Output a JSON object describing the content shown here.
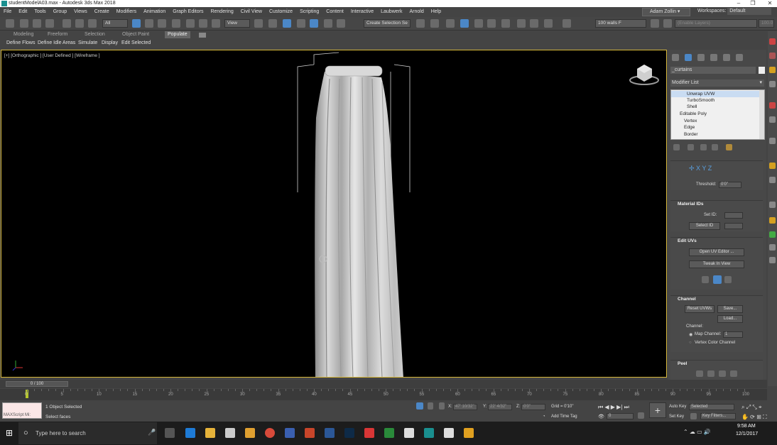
{
  "window": {
    "title": "studentModelA03.max - Autodesk 3ds Max 2018",
    "minimize": "–",
    "maximize": "❐",
    "close": "✕"
  },
  "menu": [
    "File",
    "Edit",
    "Tools",
    "Group",
    "Views",
    "Create",
    "Modifiers",
    "Animation",
    "Graph Editors",
    "Rendering",
    "Civil View",
    "Customize",
    "Scripting",
    "Content",
    "Interactive",
    "Laubwerk",
    "Arnold",
    "Help"
  ],
  "user": {
    "name": "Adam Zollin",
    "workspace_label": "Workspaces:",
    "workspace": "Default"
  },
  "toolbar": {
    "filter": "All",
    "ref_coord": "View",
    "selection_set": "Create Selection Se",
    "walls": "100  walls F",
    "layers_placeholder": "(Enable Layers)",
    "layers_value": "100.0"
  },
  "ribbon": {
    "tabs": [
      "Modeling",
      "Freeform",
      "Selection",
      "Object Paint",
      "Populate"
    ],
    "subtabs": [
      "Define Flows",
      "Define Idle Areas",
      "Simulate",
      "Display",
      "Edit Selected"
    ]
  },
  "viewport": {
    "label": "[+] [Orthographic ] [User Defined ] [Wireframe ]"
  },
  "command_panel": {
    "object_name": "_curtains",
    "modifier_list": "Modifier List",
    "stack": [
      "Unwrap UVW",
      "TurboSmooth",
      "Shell",
      "Editable Poly",
      "Vertex",
      "Edge",
      "Border"
    ],
    "threshold_label": "Threshold:",
    "threshold_value": "0'0\"",
    "material_ids": {
      "title": "Material IDs",
      "set_id": "Set ID:",
      "select_id": "Select ID"
    },
    "edit_uvs": {
      "title": "Edit UVs",
      "open_editor": "Open UV Editor ...",
      "tweak": "Tweak In View"
    },
    "channel": {
      "title": "Channel",
      "reset": "Reset UVWs",
      "save": "Save...",
      "load": "Load...",
      "channel_label": "Channel:",
      "map_channel": "Map Channel:",
      "map_channel_value": "1",
      "vertex_color": "Vertex Color Channel"
    },
    "peel": {
      "title": "Peel"
    }
  },
  "timeline": {
    "frame": "0 / 100",
    "ticks": [
      "0",
      "5",
      "10",
      "15",
      "20",
      "25",
      "30",
      "35",
      "40",
      "45",
      "50",
      "55",
      "60",
      "65",
      "70",
      "75",
      "80",
      "85",
      "90",
      "95",
      "100"
    ]
  },
  "status": {
    "maxscript": "MAXScript Mi:",
    "selected": "1 Object Selected",
    "prompt": "Select faces",
    "x_label": "X:",
    "x": "47' 10/32\"",
    "y_label": "Y:",
    "y": "22' 4/32\"",
    "z_label": "Z:",
    "z": "0'0\"",
    "grid": "Grid = 0'10\"",
    "add_time_tag": "Add Time Tag",
    "auto_key": "Auto Key",
    "set_key": "Set Key",
    "key_mode": "Selected",
    "key_filters": "Key Filters...",
    "frame_value": "0"
  },
  "taskbar": {
    "search_placeholder": "Type here to search",
    "time": "9:58 AM",
    "date": "12/1/2017"
  }
}
